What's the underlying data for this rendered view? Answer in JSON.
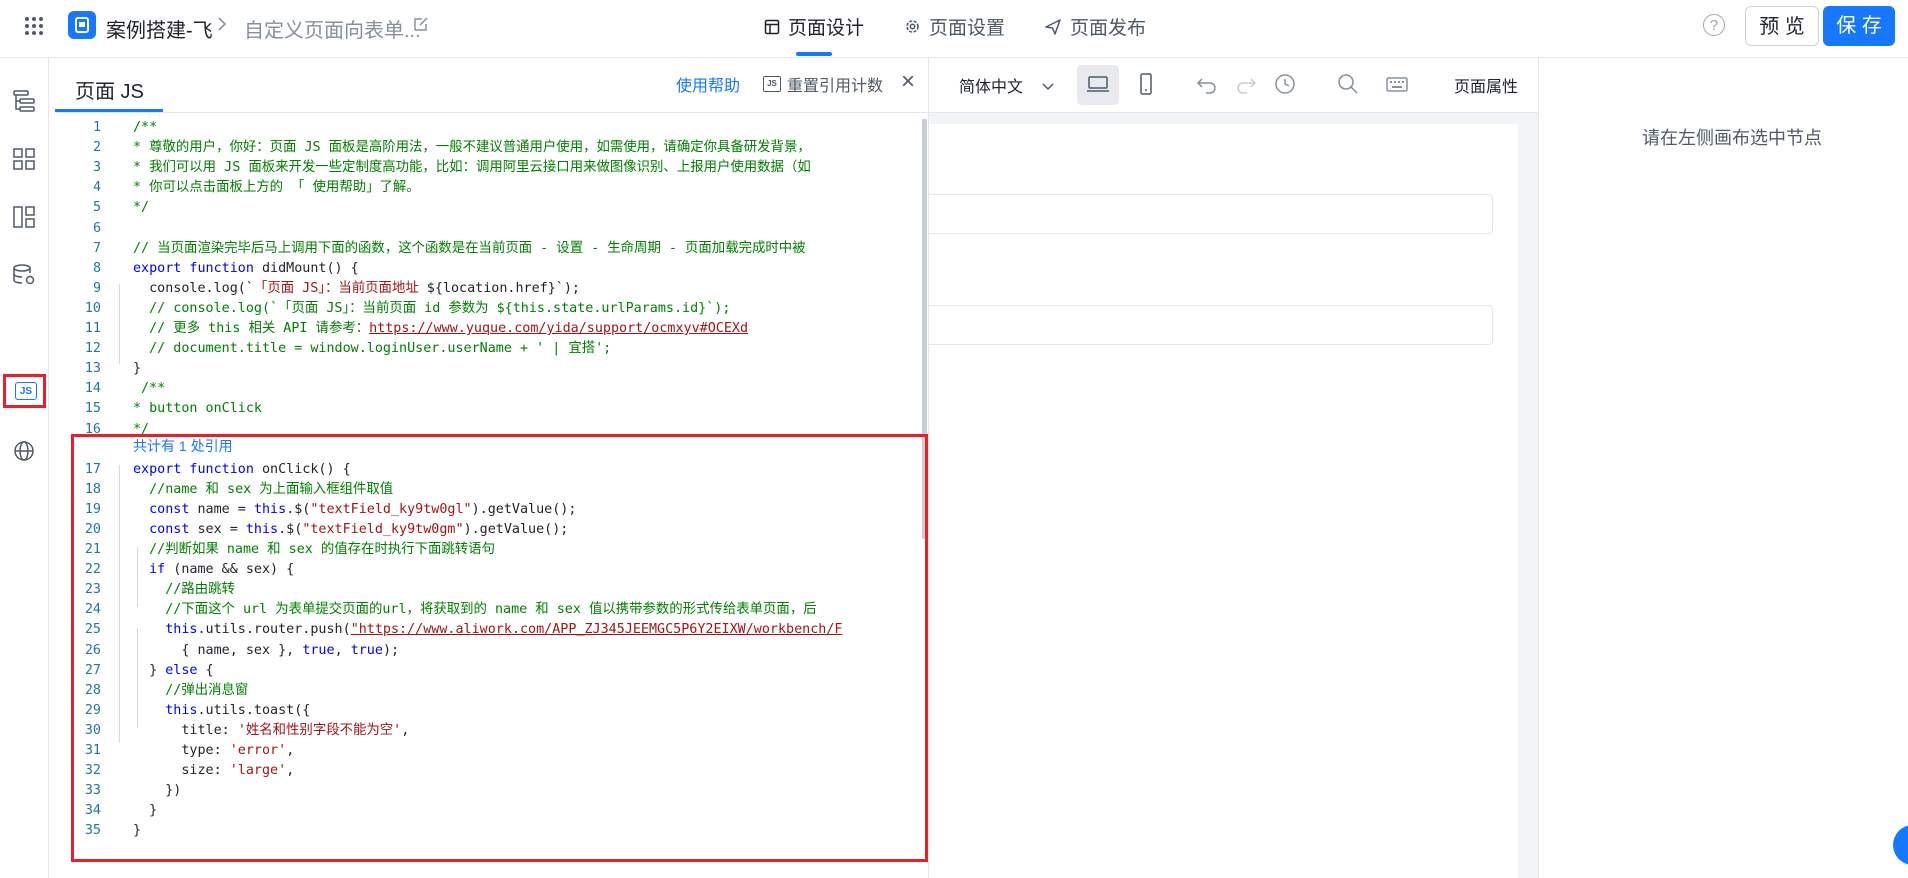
{
  "header": {
    "app_name": "案例搭建-飞",
    "form_name": "自定义页面向表单...",
    "tabs": [
      {
        "label": "页面设计",
        "icon": "layout-icon",
        "active": true
      },
      {
        "label": "页面设置",
        "icon": "gear-icon",
        "active": false
      },
      {
        "label": "页面发布",
        "icon": "send-icon",
        "active": false
      }
    ],
    "help_glyph": "?",
    "preview_label": "预 览",
    "save_label": "保 存",
    "accent_color": "#1677ff"
  },
  "rail": {
    "items": [
      "outline-icon",
      "components-icon",
      "templates-icon",
      "datasource-icon",
      "js-icon",
      "globe-icon"
    ],
    "js_badge": "JS",
    "selected": "js-icon",
    "highlight_color": "#e8202a"
  },
  "js_panel": {
    "title": "页面 JS",
    "help_link": "使用帮助",
    "reset_label": "重置引用计数",
    "reset_badge": "JS",
    "close_glyph": "×",
    "reference_hint": "共计有 1 处引用"
  },
  "code_lines": [
    {
      "n": "1",
      "parts": [
        [
          "c-com",
          "/**"
        ]
      ]
    },
    {
      "n": "2",
      "parts": [
        [
          "c-com",
          "* 尊敬的用户，你好：页面 JS 面板是高阶用法，一般不建议普通用户使用，如需使用，请确定你具备研发背景，"
        ]
      ]
    },
    {
      "n": "3",
      "parts": [
        [
          "c-com",
          "* 我们可以用 JS 面板来开发一些定制度高功能，比如：调用阿里云接口用来做图像识别、上报用户使用数据（如"
        ]
      ]
    },
    {
      "n": "4",
      "parts": [
        [
          "c-com",
          "* 你可以点击面板上方的 「 使用帮助」了解。"
        ]
      ]
    },
    {
      "n": "5",
      "parts": [
        [
          "c-com",
          "*/"
        ]
      ]
    },
    {
      "n": "6",
      "parts": [
        [
          "",
          ""
        ]
      ]
    },
    {
      "n": "7",
      "parts": [
        [
          "c-com",
          "// 当页面渲染完毕后马上调用下面的函数，这个函数是在当前页面 - 设置 - 生命周期 - 页面加载完成时中被"
        ]
      ]
    },
    {
      "n": "8",
      "parts": [
        [
          "c-kw",
          "export function"
        ],
        [
          "",
          " didMount() {"
        ]
      ]
    },
    {
      "n": "9",
      "parts": [
        [
          "",
          "  console.log(`"
        ],
        [
          "c-str",
          "「页面 JS」：当前页面地址 "
        ],
        [
          "",
          "${location.href}`);"
        ]
      ]
    },
    {
      "n": "10",
      "parts": [
        [
          "c-com",
          "  // console.log(`「页面 JS」：当前页面 id 参数为 ${this.state.urlParams.id}`);"
        ]
      ]
    },
    {
      "n": "11",
      "parts": [
        [
          "c-com",
          "  // 更多 this 相关 API 请参考："
        ],
        [
          "c-url",
          "https://www.yuque.com/yida/support/ocmxyv#OCEXd"
        ]
      ]
    },
    {
      "n": "12",
      "parts": [
        [
          "c-com",
          "  // document.title = window.loginUser.userName + ' | 宜搭';"
        ]
      ]
    },
    {
      "n": "13",
      "parts": [
        [
          "",
          "}"
        ]
      ]
    },
    {
      "n": "14",
      "parts": [
        [
          "c-com",
          " /**"
        ]
      ]
    },
    {
      "n": "15",
      "parts": [
        [
          "c-com",
          "* button onClick"
        ]
      ]
    },
    {
      "n": "16",
      "parts": [
        [
          "c-com",
          "*/"
        ]
      ]
    },
    {
      "n": "17",
      "parts": [
        [
          "c-kw",
          "export function"
        ],
        [
          "",
          " onClick() {"
        ]
      ]
    },
    {
      "n": "18",
      "parts": [
        [
          "c-com",
          "  //name 和 sex 为上面输入框组件取值"
        ]
      ]
    },
    {
      "n": "19",
      "parts": [
        [
          "c-kw",
          "  const"
        ],
        [
          "",
          " name = "
        ],
        [
          "c-kw",
          "this"
        ],
        [
          "",
          ".$("
        ],
        [
          "c-str",
          "\"textField_ky9tw0gl\""
        ],
        [
          "",
          ").getValue();"
        ]
      ]
    },
    {
      "n": "20",
      "parts": [
        [
          "c-kw",
          "  const"
        ],
        [
          "",
          " sex = "
        ],
        [
          "c-kw",
          "this"
        ],
        [
          "",
          ".$("
        ],
        [
          "c-str",
          "\"textField_ky9tw0gm\""
        ],
        [
          "",
          ").getValue();"
        ]
      ]
    },
    {
      "n": "21",
      "parts": [
        [
          "c-com",
          "  //判断如果 name 和 sex 的值存在时执行下面跳转语句"
        ]
      ]
    },
    {
      "n": "22",
      "parts": [
        [
          "c-kw",
          "  if"
        ],
        [
          "",
          " (name && sex) {"
        ]
      ]
    },
    {
      "n": "23",
      "parts": [
        [
          "c-com",
          "    //路由跳转"
        ]
      ]
    },
    {
      "n": "24",
      "parts": [
        [
          "c-com",
          "    //下面这个 url 为表单提交页面的url，将获取到的 name 和 sex 值以携带参数的形式传给表单页面，后"
        ]
      ]
    },
    {
      "n": "25",
      "parts": [
        [
          "c-kw",
          "    this"
        ],
        [
          "",
          ".utils.router.push("
        ],
        [
          "c-url",
          "\"https://www.aliwork.com/APP_ZJ345JEEMGC5P6Y2EIXW/workbench/F"
        ]
      ]
    },
    {
      "n": "26",
      "parts": [
        [
          "",
          "      { name, sex }, "
        ],
        [
          "c-kw",
          "true"
        ],
        [
          "",
          ", "
        ],
        [
          "c-kw",
          "true"
        ],
        [
          "",
          ");"
        ]
      ]
    },
    {
      "n": "27",
      "parts": [
        [
          "",
          "  } "
        ],
        [
          "c-kw",
          "else"
        ],
        [
          "",
          " {"
        ]
      ]
    },
    {
      "n": "28",
      "parts": [
        [
          "c-com",
          "    //弹出消息窗"
        ]
      ]
    },
    {
      "n": "29",
      "parts": [
        [
          "c-kw",
          "    this"
        ],
        [
          "",
          ".utils.toast({"
        ]
      ]
    },
    {
      "n": "30",
      "parts": [
        [
          "",
          "      title: "
        ],
        [
          "c-str",
          "'姓名和性别字段不能为空'"
        ],
        [
          "",
          ","
        ]
      ]
    },
    {
      "n": "31",
      "parts": [
        [
          "",
          "      type: "
        ],
        [
          "c-str",
          "'error'"
        ],
        [
          "",
          ","
        ]
      ]
    },
    {
      "n": "32",
      "parts": [
        [
          "",
          "      size: "
        ],
        [
          "c-str",
          "'large'"
        ],
        [
          "",
          ","
        ]
      ]
    },
    {
      "n": "33",
      "parts": [
        [
          "",
          "    })"
        ]
      ]
    },
    {
      "n": "34",
      "parts": [
        [
          "",
          "  }"
        ]
      ]
    },
    {
      "n": "35",
      "parts": [
        [
          "",
          "}"
        ]
      ]
    }
  ],
  "canvas_toolbar": {
    "language": "简体中文",
    "tools": [
      "desktop-icon",
      "mobile-icon",
      "undo-icon",
      "redo-icon",
      "history-icon",
      "search-icon",
      "keyboard-icon"
    ],
    "page_props_label": "页面属性"
  },
  "right_panel": {
    "empty_hint": "请在左侧画布选中节点"
  }
}
